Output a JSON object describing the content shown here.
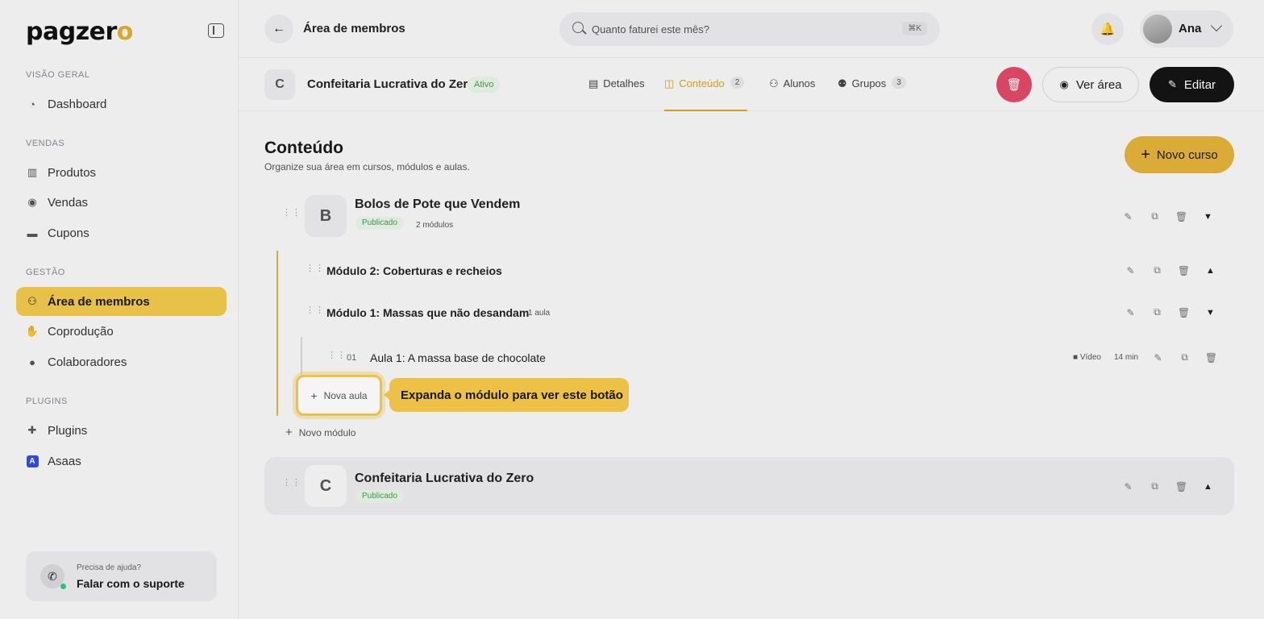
{
  "sidebar": {
    "logo_text": "pagzer",
    "logo_o": "o",
    "sections": [
      {
        "label": "VISÃO GERAL"
      },
      {
        "label": "VENDAS"
      },
      {
        "label": "GESTÃO"
      },
      {
        "label": "PLUGINS"
      }
    ],
    "items": [
      {
        "label": "Dashboard",
        "icon": "dashboard-icon"
      },
      {
        "label": "Produtos",
        "icon": "products-icon"
      },
      {
        "label": "Vendas",
        "icon": "sales-icon"
      },
      {
        "label": "Cupons",
        "icon": "coupon-icon"
      },
      {
        "label": "Área de membros",
        "icon": "members-icon",
        "active": true
      },
      {
        "label": "Coprodução",
        "icon": "handshake-icon"
      },
      {
        "label": "Colaboradores",
        "icon": "collaborators-icon"
      },
      {
        "label": "Plugins",
        "icon": "puzzle-icon"
      },
      {
        "label": "Asaas",
        "icon": "asaas-icon",
        "icon_letter": "A"
      }
    ],
    "help": {
      "line1": "Precisa de ajuda?",
      "line2": "Falar com o suporte"
    }
  },
  "header": {
    "title": "Área de membros",
    "search_placeholder": "Quanto faturei este mês?",
    "search_shortcut": "⌘K",
    "user_name": "Ana"
  },
  "product": {
    "avatar_letter": "C",
    "name": "Confeitaria Lucrativa do Zero",
    "status": "Ativo",
    "tabs": [
      {
        "label": "Detalhes",
        "count": ""
      },
      {
        "label": "Conteúdo",
        "count": "2",
        "active": true
      },
      {
        "label": "Alunos",
        "count": ""
      },
      {
        "label": "Grupos",
        "count": "3"
      }
    ],
    "ver_area_label": "Ver área",
    "editar_label": "Editar"
  },
  "content": {
    "title": "Conteúdo",
    "subtitle": "Organize sua área em cursos, módulos e aulas.",
    "new_course_label": "Novo curso",
    "courses": [
      {
        "avatar_letter": "B",
        "name": "Bolos de Pote que Vendem",
        "status": "Publicado",
        "module_count": "2 módulos",
        "modules": [
          {
            "name": "Módulo 2: Coberturas e recheios",
            "lessons_label": ""
          },
          {
            "name": "Módulo 1: Massas que não desandam",
            "lessons_label": "1 aula",
            "lessons": [
              {
                "number": "01",
                "name": "Aula 1: A massa base de chocolate",
                "type": "Vídeo",
                "duration": "14 min"
              }
            ]
          }
        ]
      },
      {
        "avatar_letter": "C",
        "name": "Confeitaria Lucrativa do Zero",
        "status": "Publicado"
      }
    ],
    "new_lesson_label": "Nova aula",
    "new_module_label": "Novo módulo",
    "tooltip": "Expanda o módulo para ver este botão"
  },
  "colors": {
    "accent": "#e3b43a",
    "active_nav": "#f2c94c",
    "danger": "#e04a68",
    "success_text": "#4a9a4a"
  }
}
